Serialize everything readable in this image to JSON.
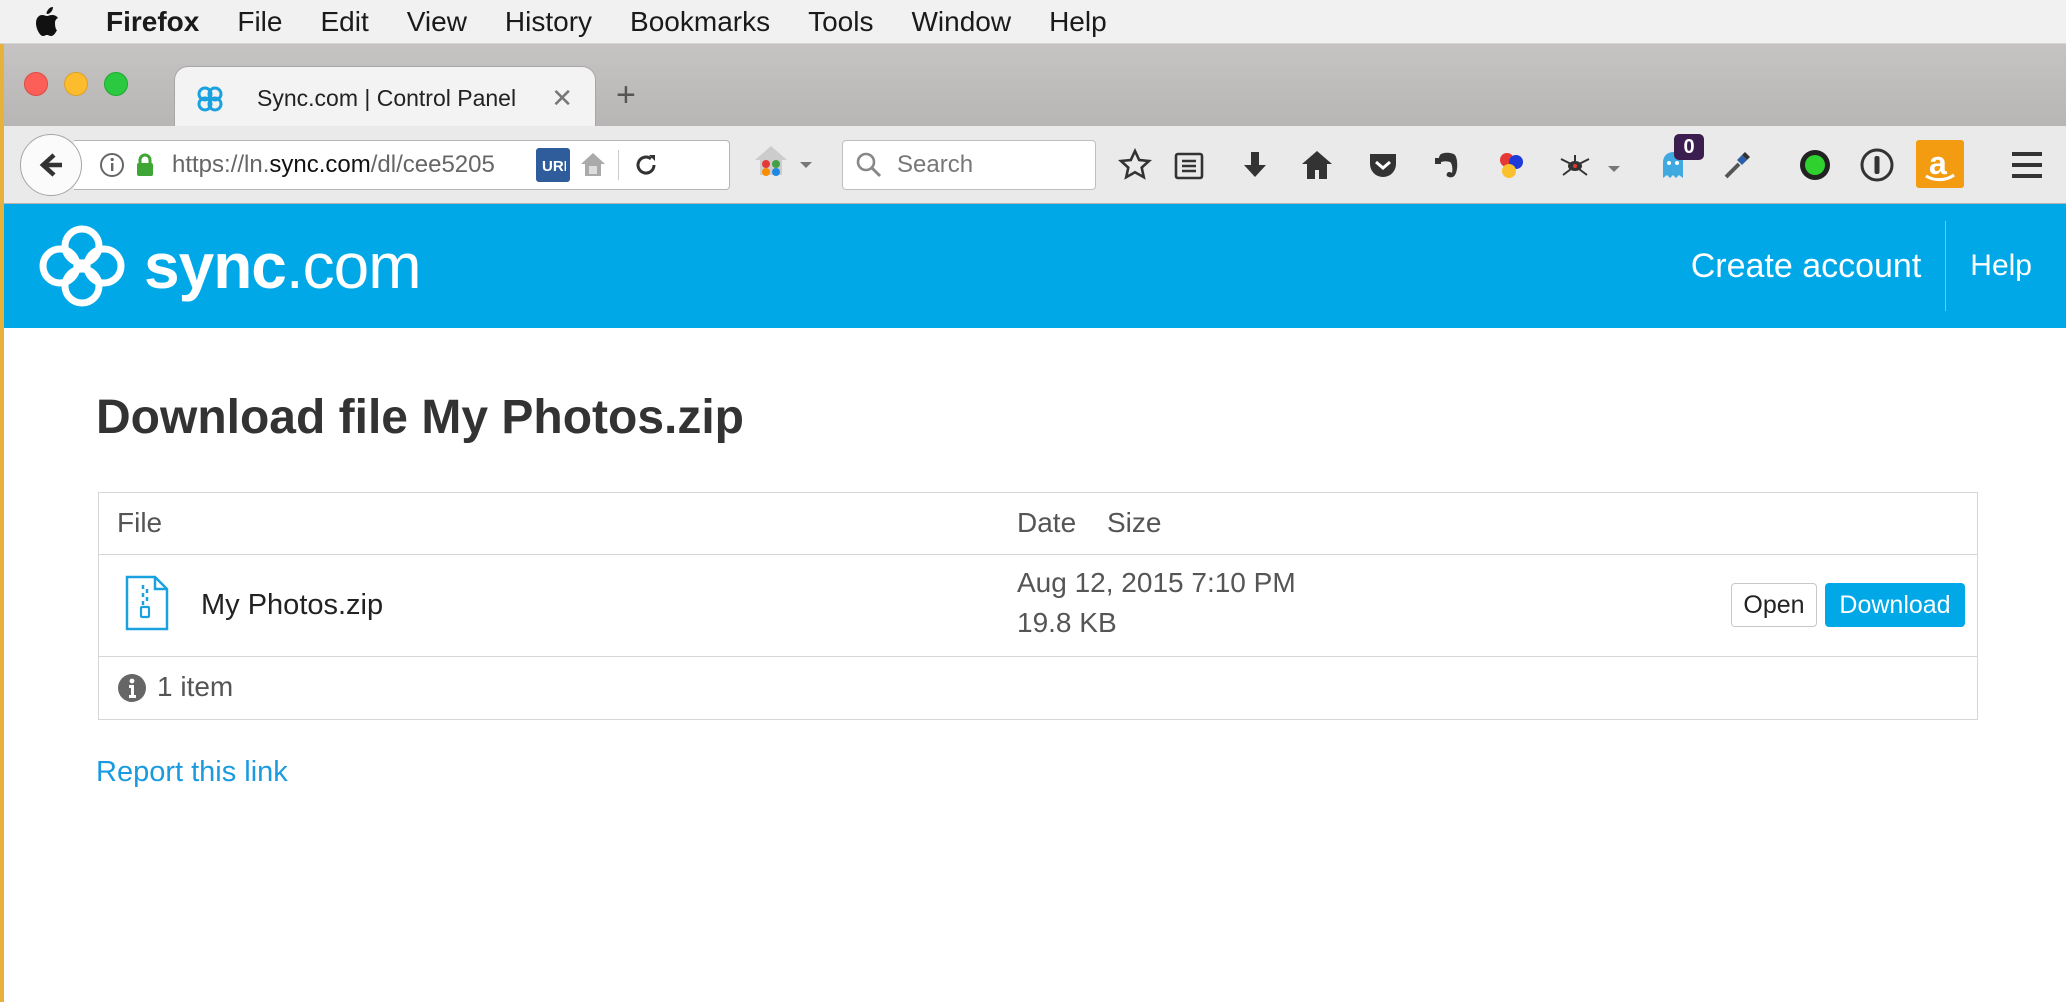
{
  "menubar": {
    "app": "Firefox",
    "items": [
      "File",
      "Edit",
      "View",
      "History",
      "Bookmarks",
      "Tools",
      "Window",
      "Help"
    ]
  },
  "browser": {
    "tab_title": "Sync.com | Control Panel",
    "url_prefix": "https://ln.",
    "url_host": "sync.com",
    "url_path": "/dl/cee5205",
    "search_placeholder": "Search",
    "notification_badge": "0"
  },
  "header": {
    "logo_bold": "sync",
    "logo_light": ".com",
    "create_account": "Create account",
    "help": "Help"
  },
  "main": {
    "title": "Download file My Photos.zip",
    "columns": {
      "file": "File",
      "date": "Date",
      "size": "Size"
    },
    "file": {
      "name": "My Photos.zip",
      "date": "Aug 12, 2015 7:10 PM",
      "size": "19.8 KB"
    },
    "open_label": "Open",
    "download_label": "Download",
    "item_count": "1 item",
    "report_link": "Report this link"
  },
  "colors": {
    "brand": "#00a8e8",
    "link": "#1a9be0"
  }
}
